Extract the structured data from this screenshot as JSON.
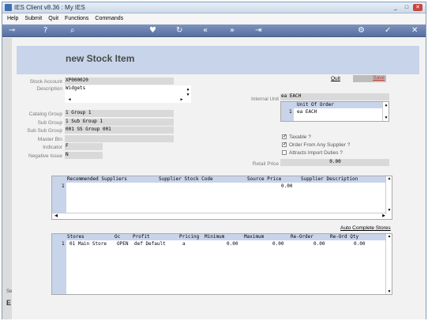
{
  "window": {
    "title": "IES Client v8.36 : My IES",
    "min_glyph": "_",
    "max_glyph": "□",
    "close_glyph": "✕"
  },
  "menu": [
    "Help",
    "Submit",
    "Quit",
    "Functions",
    "Commands"
  ],
  "toolbar_icons": [
    "key-icon",
    "help-icon",
    "search-icon",
    "heart-icon",
    "refresh-icon",
    "rewind-icon",
    "forward-icon",
    "end-icon",
    "settings-icon",
    "check-icon",
    "close-icon"
  ],
  "form": {
    "title": "new Stock Item",
    "quit_label": "Quit",
    "save_label": "Save",
    "labels": {
      "stock_account": "Stock Account",
      "description": "Description",
      "catalog_group": "Catalog Group",
      "sub_group": "Sub Group",
      "sub_sub_group": "Sub Sub Group",
      "master_bin": "Master Bin",
      "indicator": "Indicator",
      "negative_issue": "Negative Issue",
      "internal_unit": "Internal Unit",
      "retail_price": "Retail Price"
    },
    "values": {
      "stock_account": "XP000020",
      "description": "Widgets",
      "catalog_group": "1 Group 1",
      "sub_group": "1 Sub Group 1",
      "sub_sub_group": "001 SS Group 001",
      "master_bin": "",
      "indicator": "F",
      "negative_issue": "N",
      "internal_unit": "ea EACH",
      "retail_price": "0.00"
    },
    "unit_list": {
      "header": "Unit Of Order",
      "row_no": "1",
      "row_value": "ea EACH"
    },
    "checkboxes": [
      {
        "label": "Taxable ?",
        "checked": true
      },
      {
        "label": "Order From Any Supplier ?",
        "checked": true
      },
      {
        "label": "Attracts Import Duties ?",
        "checked": false
      }
    ]
  },
  "suppliers_grid": {
    "columns": [
      "Recommended Suppliers",
      "Supplier Stock Code",
      "Source Price",
      "Supplier Description"
    ],
    "rows": [
      {
        "no": "1",
        "source_price": "0.00"
      }
    ]
  },
  "auto_complete_label": "Auto Complete Stores",
  "stores_grid": {
    "columns": [
      "Stores",
      "Oc",
      "Profit",
      "Pricing",
      "Minimum",
      "Maximum",
      "Re-Order",
      "Re-Ord Qty"
    ],
    "rows": [
      {
        "no": "1",
        "store": "01 Main Store",
        "oc": "OPEN",
        "profit": "def Default",
        "pricing": "a",
        "minimum": "0.00",
        "maximum": "0.00",
        "reorder": "0.00",
        "reord_qty": "0.00"
      }
    ]
  },
  "status_left": {
    "top": "Se",
    "bottom": "E"
  }
}
